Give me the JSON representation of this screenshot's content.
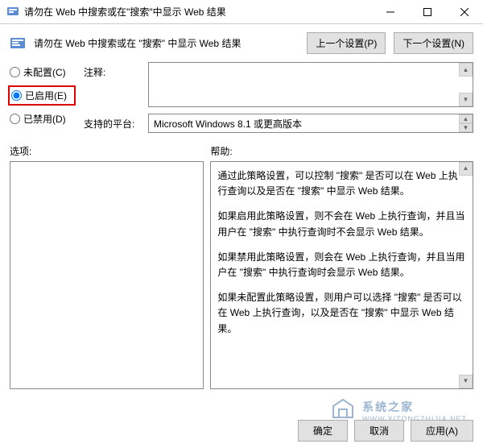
{
  "titlebar": {
    "title": "请勿在 Web 中搜索或在\"搜索\"中显示 Web 结果"
  },
  "header": {
    "text": "请勿在 Web 中搜索或在 \"搜索\" 中显示 Web 结果",
    "prev_btn": "上一个设置(P)",
    "next_btn": "下一个设置(N)"
  },
  "radios": {
    "not_configured": "未配置(C)",
    "enabled": "已启用(E)",
    "disabled": "已禁用(D)",
    "selected": "enabled"
  },
  "fields": {
    "comment_label": "注释:",
    "comment_value": "",
    "platform_label": "支持的平台:",
    "platform_value": "Microsoft Windows 8.1 或更高版本"
  },
  "lower": {
    "options_label": "选项:",
    "help_label": "帮助:",
    "help_paragraphs": [
      "通过此策略设置，可以控制 \"搜索\" 是否可以在 Web 上执行查询以及是否在 \"搜索\" 中显示 Web 结果。",
      "如果启用此策略设置，则不会在 Web 上执行查询，并且当用户在 \"搜索\" 中执行查询时不会显示 Web 结果。",
      "如果禁用此策略设置，则会在 Web 上执行查询，并且当用户在 \"搜索\" 中执行查询时会显示 Web 结果。",
      "如果未配置此策略设置，则用户可以选择 \"搜索\" 是否可以在 Web 上执行查询，以及是否在 \"搜索\" 中显示 Web 结果。"
    ]
  },
  "footer": {
    "ok": "确定",
    "cancel": "取消",
    "apply": "应用(A)"
  },
  "watermark": {
    "top": "系统之家",
    "bottom": "WWW.XITONGZHIJIA.NET"
  }
}
